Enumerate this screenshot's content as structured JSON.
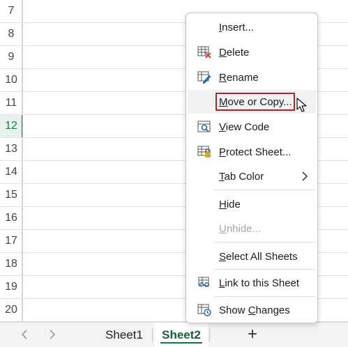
{
  "rows": {
    "labels": [
      "7",
      "8",
      "9",
      "10",
      "11",
      "12",
      "13",
      "14",
      "15",
      "16",
      "17",
      "18",
      "19",
      "20"
    ],
    "selected": "12"
  },
  "tabs": {
    "prev_icon": "chevron-left-icon",
    "next_icon": "chevron-right-icon",
    "sheets": [
      "Sheet1",
      "Sheet2"
    ],
    "active": "Sheet2",
    "add_label": "+"
  },
  "menu": {
    "items": [
      {
        "label": "Insert...",
        "accel": "I",
        "icon": "none"
      },
      {
        "label": "Delete",
        "accel": "D",
        "icon": "delete-sheet-icon"
      },
      {
        "label": "Rename",
        "accel": "R",
        "icon": "rename-sheet-icon"
      },
      {
        "label": "Move or Copy...",
        "accel": "M",
        "icon": "none",
        "state": "hover"
      },
      {
        "label": "View Code",
        "accel": "V",
        "icon": "view-code-icon"
      },
      {
        "label": "Protect Sheet...",
        "accel": "P",
        "icon": "protect-sheet-icon"
      },
      {
        "label": "Tab Color",
        "accel": "T",
        "icon": "none",
        "submenu": true
      },
      {
        "label": "Hide",
        "accel": "H",
        "icon": "none"
      },
      {
        "label": "Unhide...",
        "accel": "U",
        "icon": "none",
        "disabled": true
      },
      {
        "label": "Select All Sheets",
        "accel": "S",
        "icon": "none"
      },
      {
        "label": "Link to this Sheet",
        "accel": "L",
        "icon": "link-sheet-icon"
      },
      {
        "label": "Show Changes",
        "accel": "C",
        "icon": "show-changes-icon"
      }
    ]
  },
  "colors": {
    "accent_green": "#107c41",
    "highlight_red": "#b3202a",
    "delete_x_red": "#d13438",
    "lock_orange": "#e8a317",
    "icon_blue": "#2b6cb0"
  }
}
